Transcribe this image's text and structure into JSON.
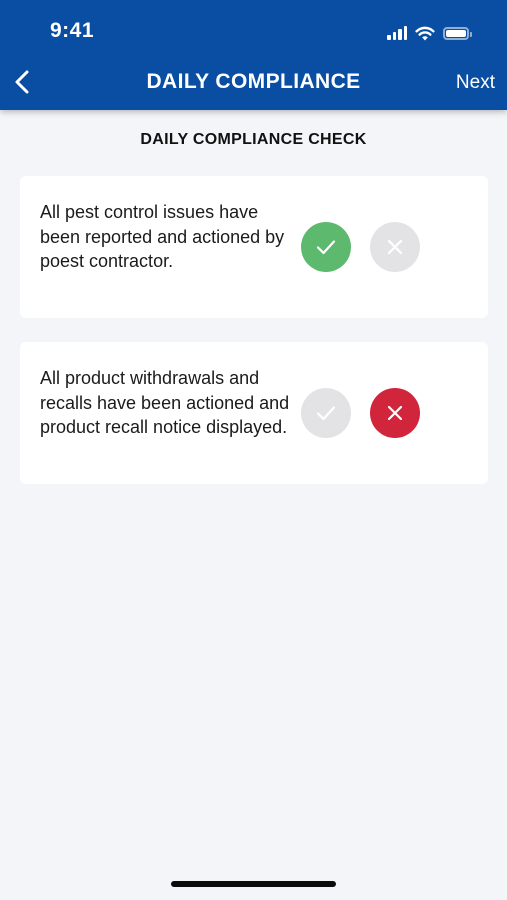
{
  "status_bar": {
    "time": "9:41"
  },
  "nav": {
    "title": "DAILY COMPLIANCE",
    "next_label": "Next",
    "back_icon": "chevron-left-icon"
  },
  "section_title": "DAILY COMPLIANCE CHECK",
  "checks": [
    {
      "text": "All pest control issues have been reported and actioned by poest contractor.",
      "answer": "yes"
    },
    {
      "text": "All product withdrawals and recalls have been actioned and product recall notice displayed.",
      "answer": "no"
    }
  ],
  "colors": {
    "header_bg": "#0a4ea3",
    "yes_active": "#5cb96d",
    "no_active": "#d1253c",
    "inactive": "#e3e3e5",
    "page_bg": "#f3f5f8"
  }
}
